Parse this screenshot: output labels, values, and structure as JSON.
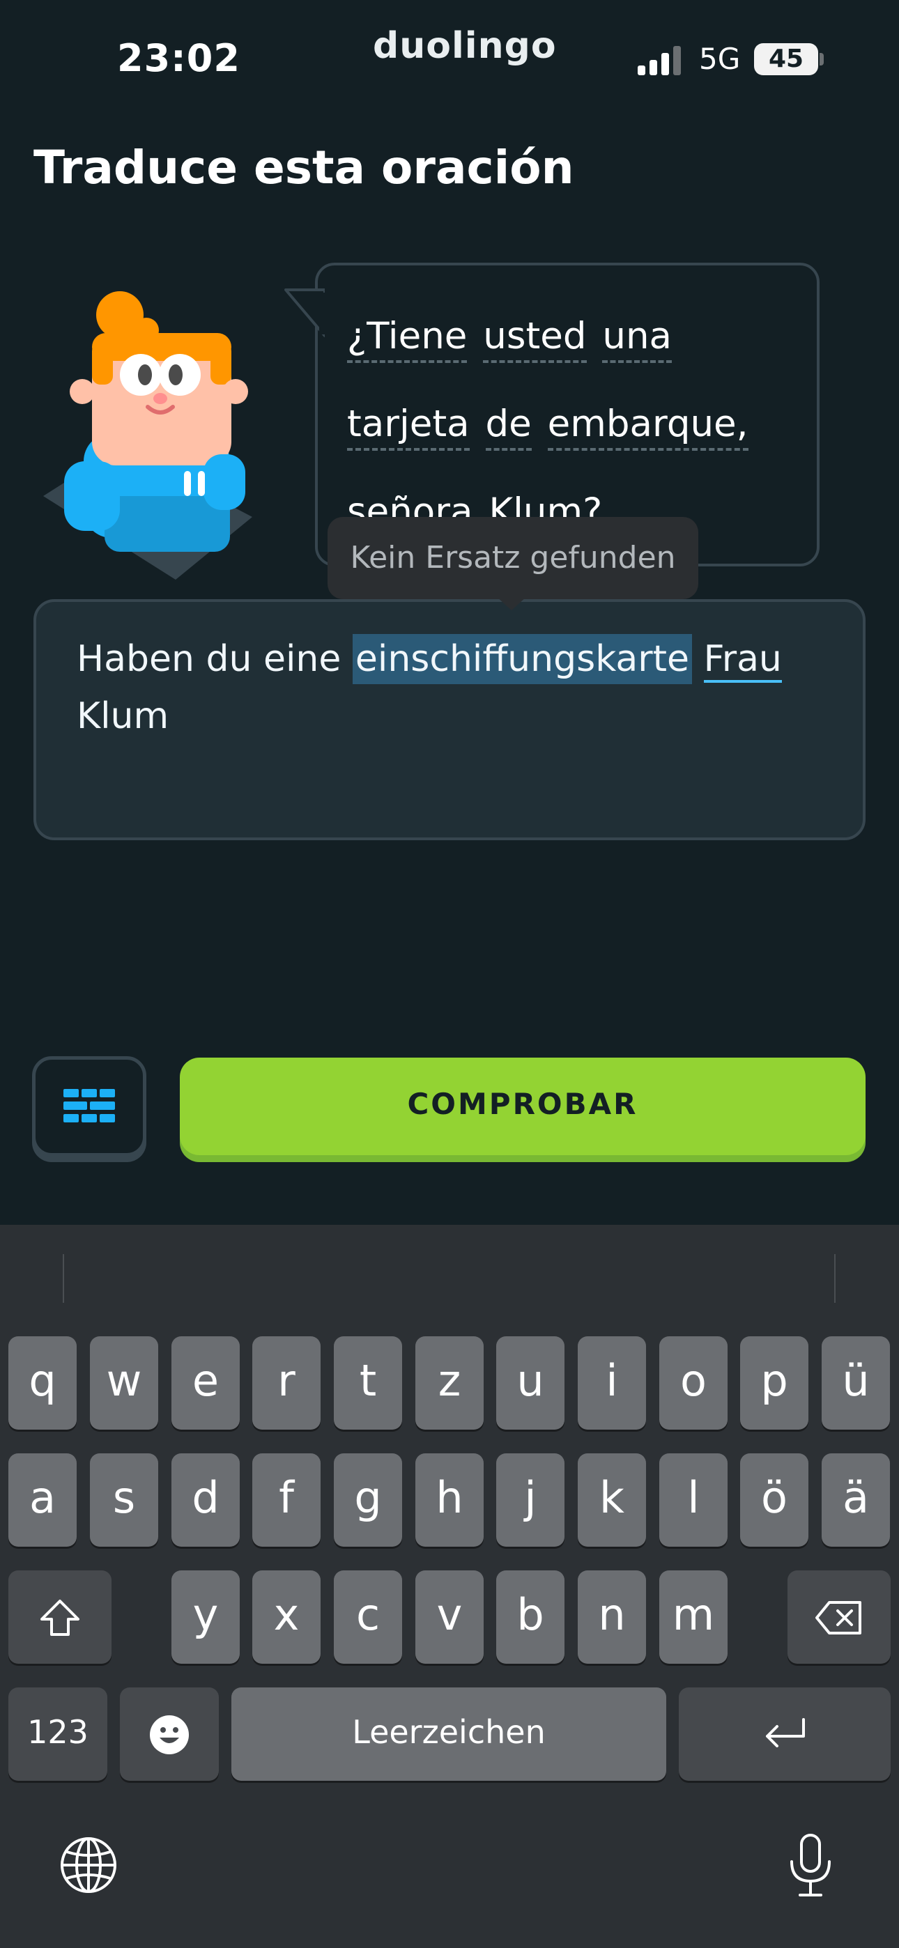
{
  "status_bar": {
    "time": "23:02",
    "app": "duolingo",
    "network": "5G",
    "battery": "45"
  },
  "exercise": {
    "title": "Traduce esta oración",
    "prompt_words": [
      "¿Tiene",
      "usted",
      "una",
      "tarjeta",
      "de",
      "embarque,",
      "señora",
      "Klum?"
    ],
    "answer": {
      "before": "Haben du eine ",
      "highlighted": "einschiffungskarte",
      "underlined": "Frau",
      "after": "Klum"
    },
    "tooltip": "Kein Ersatz gefunden"
  },
  "actions": {
    "check": "COMPROBAR",
    "keyboard_toggle_icon": "word-bank-icon"
  },
  "keyboard": {
    "row1": [
      "q",
      "w",
      "e",
      "r",
      "t",
      "z",
      "u",
      "i",
      "o",
      "p",
      "ü"
    ],
    "row2": [
      "a",
      "s",
      "d",
      "f",
      "g",
      "h",
      "j",
      "k",
      "l",
      "ö",
      "ä"
    ],
    "row3": [
      "y",
      "x",
      "c",
      "v",
      "b",
      "n",
      "m"
    ],
    "numbers": "123",
    "space": "Leerzeichen"
  },
  "colors": {
    "background": "#131f24",
    "accent_green": "#93d333",
    "highlight": "#2b5a77"
  }
}
